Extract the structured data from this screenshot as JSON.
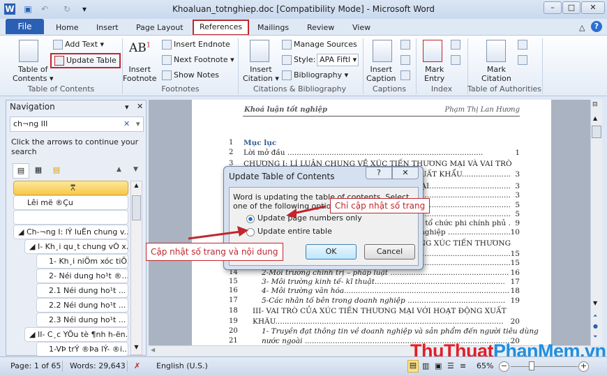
{
  "window": {
    "title": "Khoaluan_totnghiep.doc [Compatibility Mode] - Microsoft Word"
  },
  "tabs": {
    "file": "File",
    "items": [
      "Home",
      "Insert",
      "Page Layout",
      "References",
      "Mailings",
      "Review",
      "View"
    ]
  },
  "ribbon": {
    "toc": {
      "table_of": "Table of",
      "contents": "Contents",
      "add_text": "Add Text",
      "update_table": "Update Table",
      "group": "Table of Contents"
    },
    "footnotes": {
      "insert": "Insert",
      "footnote": "Footnote",
      "ab": "AB",
      "insert_endnote": "Insert Endnote",
      "next_footnote": "Next Footnote",
      "show_notes": "Show Notes",
      "group": "Footnotes"
    },
    "citations": {
      "insert": "Insert",
      "citation": "Citation",
      "manage_sources": "Manage Sources",
      "style_label": "Style:",
      "style_value": "APA Fiftl",
      "bibliography": "Bibliography",
      "group": "Citations & Bibliography"
    },
    "captions": {
      "insert": "Insert",
      "caption": "Caption",
      "group": "Captions"
    },
    "index": {
      "mark": "Mark",
      "entry": "Entry",
      "group": "Index"
    },
    "authorities": {
      "mark": "Mark",
      "citation": "Citation",
      "group": "Table of Authorities"
    }
  },
  "navigation": {
    "title": "Navigation",
    "search_value": "ch¬ng III",
    "hint": "Click the arrows to continue your search",
    "items": [
      "Lêi më ®Çu",
      "",
      "Ch-¬ng I: lÝ luËn chung v...",
      "I- Kh¸i qu¸t chung vÒ x...",
      "1- Kh¸i niÖm xóc tiÕ...",
      "2- Néi dung ho¹t ®...",
      "2.1 Néi dung ho¹t ...",
      "2.2 Néi dung ho¹t ...",
      "2.3 Néi dung ho¹t ...",
      "II- C¸c YÕu tè ¶nh h-ën...",
      "1-VÞ trÝ ®Þa lÝ- ®i..."
    ]
  },
  "document": {
    "header_left": "Khoá luận tốt nghiệp",
    "header_right": "Phạm Thị Lan Hương",
    "lines": [
      {
        "n": "1",
        "text": "Mục lục",
        "page": "",
        "style": "heading"
      },
      {
        "n": "2",
        "text": "Lời mở đầu ....................................................................................",
        "page": "1"
      },
      {
        "n": "3",
        "text": "CHƯƠNG I: LÍ LUẬN CHUNG VỀ XÚC TIẾN THƯƠNG MẠI VÀ VAI TRÒ",
        "page": ""
      },
      {
        "n": "",
        "text": "I XUẤT KHẨU.....................",
        "page": "3",
        "frag": true
      },
      {
        "n": "",
        "text": "G MẠI...................................",
        "page": "3",
        "frag": true
      },
      {
        "n": "",
        "text": "...............................................",
        "page": "3",
        "frag": true
      },
      {
        "n": "",
        "text": "...............................................",
        "page": "5",
        "frag": true
      },
      {
        "n": "",
        "text": "nước .......................................",
        "page": "5",
        "frag": true
      },
      {
        "n": "",
        "text": "các tổ chức phi chính phủ .",
        "page": "9",
        "frag": true
      },
      {
        "n": "",
        "text": "anh nghiệp ...........................",
        "page": "10",
        "frag": true
      },
      {
        "n": "",
        "text": "NG XÚC TIẾN THƯƠNG",
        "page": "",
        "frag": true
      },
      {
        "n": "",
        "text": "..............................................",
        "page": "15",
        "frag": true
      },
      {
        "n": "",
        "text": "..............................................",
        "page": "15",
        "frag": true
      },
      {
        "n": "14",
        "text": "2-Môi trường chính trị – pháp luật ...................................................",
        "page": "16",
        "style": "sub"
      },
      {
        "n": "15",
        "text": "3- Môi trường kinh tế- kĩ thuật........................................................",
        "page": "17",
        "style": "sub"
      },
      {
        "n": "16",
        "text": "4- Môi trường văn hóa.......................................................................",
        "page": "18",
        "style": "sub"
      },
      {
        "n": "17",
        "text": "5-Các nhân tố bên trong doanh nghiệp ..........................................",
        "page": "19",
        "style": "sub"
      },
      {
        "n": "18",
        "text": "III- VAI TRÒ CỦA XÚC TIẾN THƯƠNG MẠI VỚI HOẠT ĐỘNG XUẤT",
        "page": "",
        "style": "sec"
      },
      {
        "n": "19",
        "text": "KHẨU..................................................................................................",
        "page": "20",
        "style": "sec"
      },
      {
        "n": "20",
        "text": "1- Truyền đạt thông tin về doanh nghiệp và sản phẩm đến người tiêu dùng",
        "page": "",
        "style": "sub"
      },
      {
        "n": "21",
        "text": "nước ngoài ..........................................................................................",
        "page": "20",
        "style": "sub"
      }
    ]
  },
  "dialog": {
    "title": "Update Table of Contents",
    "help": "?",
    "message": "Word is updating the table of contents.  Select one of the following options:",
    "option1": "Update page numbers only",
    "option2": "Update entire table",
    "ok": "OK",
    "cancel": "Cancel",
    "selected": "option1"
  },
  "annotations": {
    "page_only": "Chỉ cập nhật số trang",
    "entire": "Cập nhật số trang và nội dung"
  },
  "watermark": {
    "part1": "ThuThuat",
    "part2": "PhanMem",
    "part3": ".vn"
  },
  "status": {
    "page": "Page: 1 of 65",
    "words": "Words: 29,643",
    "language": "English (U.S.)",
    "zoom": "65%"
  }
}
